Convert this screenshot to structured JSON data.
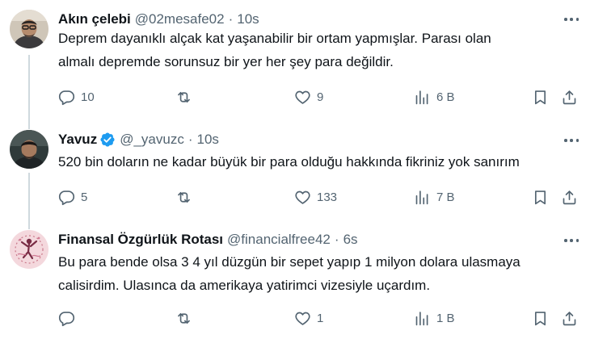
{
  "colors": {
    "text": "#0f1419",
    "secondary": "#536471",
    "verified": "#1d9bf0",
    "thread_line": "#cfd9de"
  },
  "tweets": [
    {
      "name": "Akın çelebi",
      "handle": "@02mesafe02",
      "separator": "·",
      "time": "10s",
      "verified": false,
      "text": "Deprem dayanıklı alçak kat yaşanabilir bir ortam yapmışlar. Parası olan\nalmalı depremde sorunsuz bir yer her şey para değildir.",
      "replies": "10",
      "reposts": "",
      "likes": "9",
      "views": "6 B"
    },
    {
      "name": "Yavuz",
      "handle": "@_yavuzc",
      "separator": "·",
      "time": "10s",
      "verified": true,
      "text": "520 bin doların ne kadar büyük bir para olduğu hakkında fikriniz yok sanırım",
      "replies": "5",
      "reposts": "",
      "likes": "133",
      "views": "7 B"
    },
    {
      "name": "Finansal Özgürlük Rotası",
      "handle": "@financialfree42",
      "separator": "·",
      "time": "6s",
      "verified": false,
      "text": "Bu para bende olsa 3 4 yıl düzgün bir sepet yapıp 1 milyon dolara ulasmaya\ncalisirdim. Ulasınca da amerikaya yatirimci vizesiyle uçardım.",
      "replies": "",
      "reposts": "",
      "likes": "1",
      "views": "1 B"
    }
  ],
  "icons": {
    "reply": "reply-icon",
    "repost": "repost-icon",
    "like": "heart-icon",
    "views": "views-icon",
    "bookmark": "bookmark-icon",
    "share": "share-icon",
    "more": "more-icon",
    "verified": "verified-badge-icon"
  }
}
